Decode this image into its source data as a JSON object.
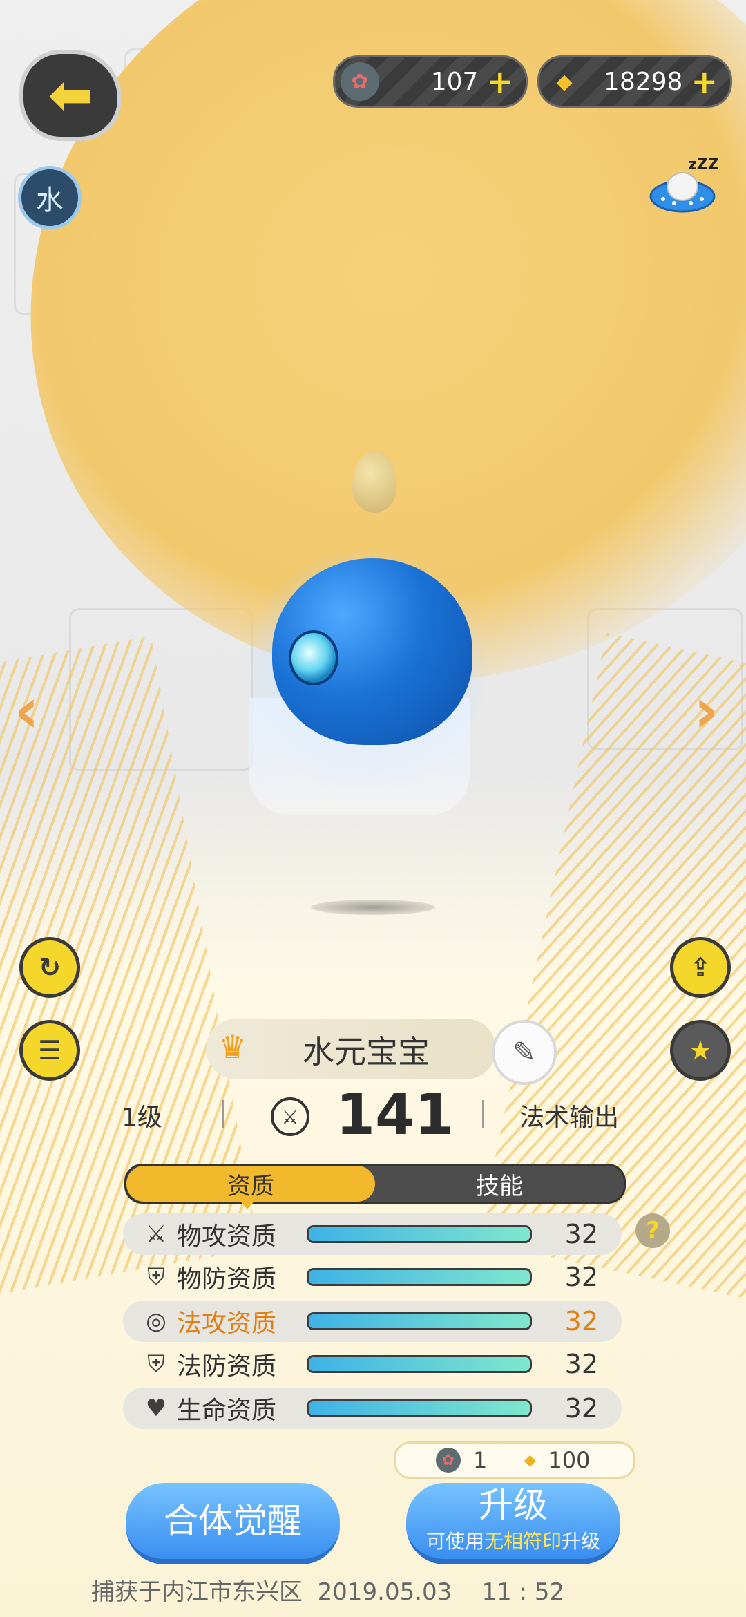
{
  "top_bar": {
    "element_badge": "水",
    "currency_1": {
      "icon": "lotus-gem-icon",
      "value": "107",
      "plus": "+"
    },
    "currency_2": {
      "icon": "gold-shard-icon",
      "value": "18298",
      "plus": "+"
    }
  },
  "pet": {
    "name": "水元宝宝",
    "level": "1级",
    "power": "141",
    "role": "法术输出"
  },
  "tabs": [
    {
      "label": "资质",
      "active": true
    },
    {
      "label": "技能",
      "active": false
    }
  ],
  "stats": [
    {
      "icon": "crossed-swords-icon",
      "label": "物攻资质",
      "value": "32",
      "fill": 1.0,
      "highlight": false
    },
    {
      "icon": "shield-icon",
      "label": "物防资质",
      "value": "32",
      "fill": 1.0,
      "highlight": false
    },
    {
      "icon": "magic-swirl-icon",
      "label": "法攻资质",
      "value": "32",
      "fill": 1.0,
      "highlight": true
    },
    {
      "icon": "magic-shield-icon",
      "label": "法防资质",
      "value": "32",
      "fill": 1.0,
      "highlight": false
    },
    {
      "icon": "heart-icon",
      "label": "生命资质",
      "value": "32",
      "fill": 1.0,
      "highlight": false
    }
  ],
  "help_label": "?",
  "cost": {
    "gem": "1",
    "gold": "100"
  },
  "buttons": {
    "merge": "合体觉醒",
    "upgrade": "升级",
    "upgrade_hint_prefix": "可使用",
    "upgrade_hint_item": "无相符印",
    "upgrade_hint_suffix": "升级"
  },
  "caught_text": "捕获于内江市东兴区  2019.05.03    11 : 52",
  "colors": {
    "accent_gold": "#f2b92c",
    "highlight_orange": "#e07f12",
    "button_blue": "#3a8ef0"
  }
}
